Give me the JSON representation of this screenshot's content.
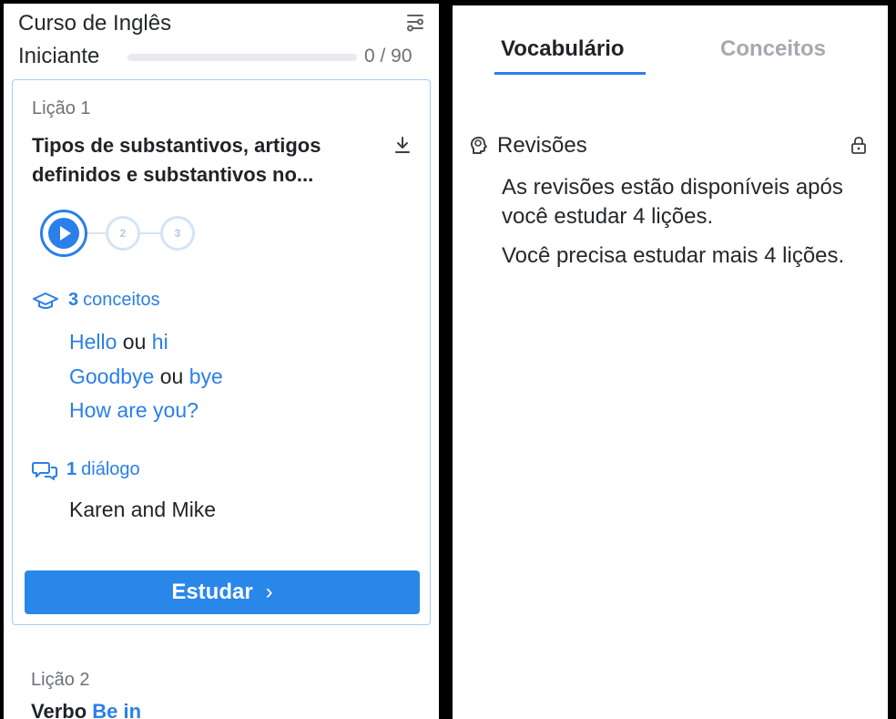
{
  "course": {
    "title": "Curso de Inglês",
    "level_label": "Iniciante",
    "progress_count": "0 / 90",
    "progress_fraction": 0.0
  },
  "lesson": {
    "number": "Lição 1",
    "title": "Tipos de substantivos, artigos definidos e substantivos no...",
    "steps": [
      "2",
      "3"
    ],
    "concepts": {
      "count": "3",
      "label": "conceitos",
      "items": [
        {
          "a": "Hello",
          "sep": " ou ",
          "b": "hi"
        },
        {
          "a": "Goodbye",
          "sep": " ou ",
          "b": "bye"
        },
        {
          "a": "How are you?"
        }
      ]
    },
    "dialogs": {
      "count": "1",
      "label": "diálogo",
      "items": [
        "Karen and Mike"
      ]
    },
    "study_button": "Estudar",
    "study_chevron": "›"
  },
  "next_lesson": {
    "number": "Lição 2",
    "title_prefix": "Verbo ",
    "title_highlight": "Be in"
  },
  "tabs": {
    "vocabulary": "Vocabulário",
    "concepts": "Conceitos"
  },
  "reviews": {
    "label": "Revisões",
    "text1": "As revisões estão disponíveis após você estudar 4 lições.",
    "text2": "Você precisa estudar mais 4 lições."
  },
  "colors": {
    "accent": "#2a7fe8",
    "button": "#2a87ea",
    "card_border": "#a8cdf2",
    "inactive_text": "#a4aab0"
  },
  "icons": [
    "filter-icon",
    "download-icon",
    "play-icon",
    "graduation-cap-icon",
    "chat-bubbles-icon",
    "brain-icon",
    "lock-icon"
  ]
}
